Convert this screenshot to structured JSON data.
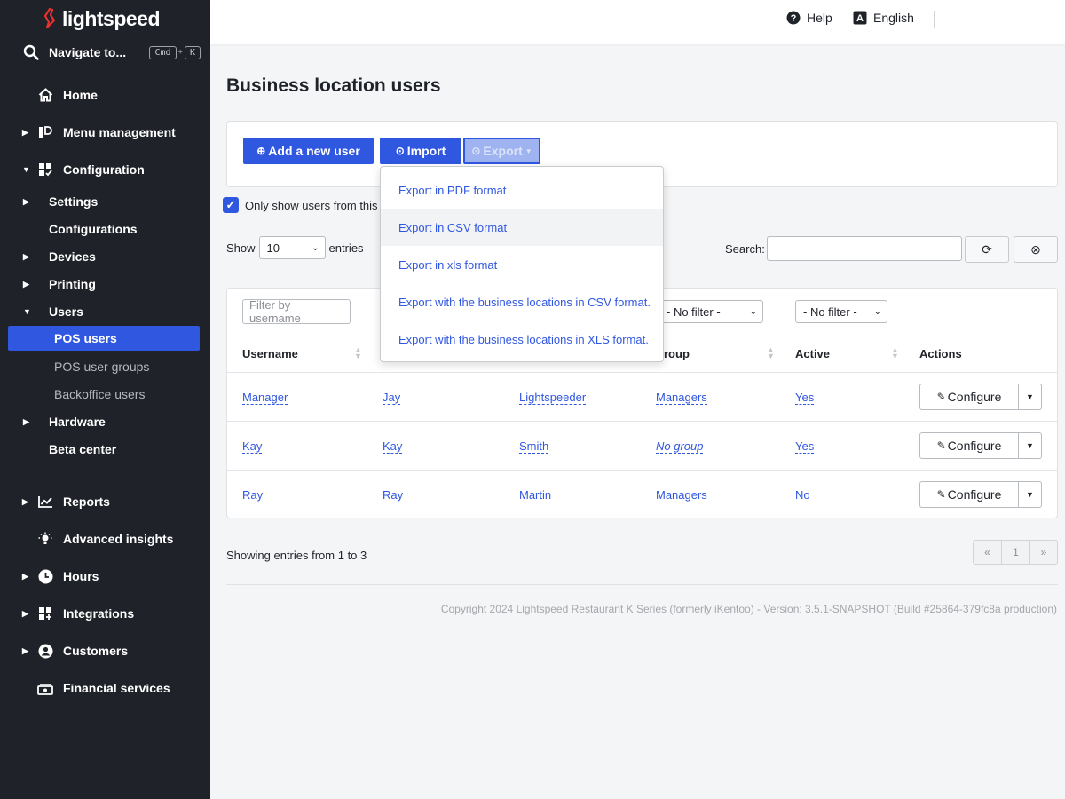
{
  "brand": {
    "name": "lightspeed",
    "accent": "#e8312f"
  },
  "nav_search": {
    "label": "Navigate to...",
    "key1": "Cmd",
    "plus": "+",
    "key2": "K"
  },
  "sidebar": {
    "home": "Home",
    "menu_management": "Menu management",
    "configuration": "Configuration",
    "settings": "Settings",
    "configurations": "Configurations",
    "devices": "Devices",
    "printing": "Printing",
    "users": "Users",
    "pos_users": "POS users",
    "pos_user_groups": "POS user groups",
    "backoffice_users": "Backoffice users",
    "hardware": "Hardware",
    "beta_center": "Beta center",
    "reports": "Reports",
    "advanced_insights": "Advanced insights",
    "hours": "Hours",
    "integrations": "Integrations",
    "customers": "Customers",
    "financial_services": "Financial services"
  },
  "topbar": {
    "help": "Help",
    "language": "English"
  },
  "page": {
    "title": "Business location users"
  },
  "toolbar": {
    "add_label": "Add a new user",
    "import_label": "Import",
    "export_label": "Export"
  },
  "export_menu": [
    "Export in PDF format",
    "Export in CSV format",
    "Export in xls format",
    "Export with the business locations in CSV format.",
    "Export with the business locations in XLS format."
  ],
  "filter_checkbox": {
    "label": "Only show users from this b",
    "checked": true
  },
  "length_control": {
    "show": "Show",
    "value": "10",
    "entries": "entries"
  },
  "search": {
    "label": "Search:",
    "value": ""
  },
  "table": {
    "filter_placeholder": "Filter by username",
    "group_filter": "- No filter -",
    "active_filter": "- No filter -",
    "headers": {
      "username": "Username",
      "group": "roup",
      "active": "Active",
      "actions": "Actions"
    },
    "rows": [
      {
        "username": "Manager",
        "first": "Jay",
        "last": "Lightspeeder",
        "group": "Managers",
        "active": "Yes",
        "action": "Configure"
      },
      {
        "username": "Kay",
        "first": "Kay",
        "last": "Smith",
        "group": "No group",
        "active": "Yes",
        "action": "Configure"
      },
      {
        "username": "Ray",
        "first": "Ray",
        "last": "Martin",
        "group": "Managers",
        "active": "No",
        "action": "Configure"
      }
    ]
  },
  "info": {
    "entries": "Showing entries from 1 to 3"
  },
  "pager": {
    "prev": "«",
    "page": "1",
    "next": "»"
  },
  "footer": {
    "copyright": "Copyright 2024 Lightspeed Restaurant K Series (formerly iKentoo) - Version: 3.5.1-SNAPSHOT (Build #25864-379fc8a production)"
  },
  "colors": {
    "primary": "#3057e0",
    "sidebar_bg": "#1f2228"
  }
}
